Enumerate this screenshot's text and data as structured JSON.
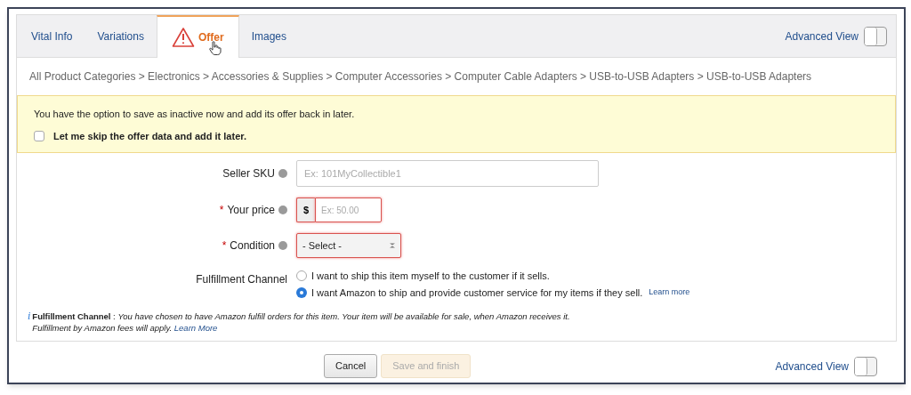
{
  "tabs": [
    {
      "label": "Vital Info",
      "selected": false,
      "warning": false
    },
    {
      "label": "Variations",
      "selected": false,
      "warning": false
    },
    {
      "label": "Offer",
      "selected": true,
      "warning": true
    },
    {
      "label": "Images",
      "selected": false,
      "warning": false
    }
  ],
  "advanced_view_top": {
    "label": "Advanced View",
    "on": false
  },
  "breadcrumb": "All Product Categories > Electronics > Accessories & Supplies > Computer Accessories > Computer Cable Adapters > USB-to-USB Adapters > USB-to-USB Adapters",
  "notice": {
    "text": "You have the option to save as inactive now and add its offer back in later.",
    "checkbox": {
      "label": "Let me skip the offer data and add it later.",
      "checked": false
    }
  },
  "fields": [
    {
      "kind": "text",
      "label": "Seller SKU",
      "error": false,
      "placeholder": "Ex: 101MyCollectible1"
    },
    {
      "kind": "price",
      "label": "Your price",
      "required_mark": "*",
      "error": true,
      "prefix": "$",
      "placeholder": "Ex: 50.00"
    },
    {
      "kind": "select",
      "label": "Condition",
      "required_mark": "*",
      "error": true,
      "value": "- Select -"
    }
  ],
  "fulfillment": {
    "label": "Fulfillment Channel",
    "options": [
      {
        "label": "I want to ship this item myself to the customer if it sells.",
        "selected": false
      },
      {
        "label": "I want Amazon to ship and provide customer service for my items if they sell.",
        "selected": true,
        "link": "Learn more"
      }
    ]
  },
  "note": {
    "icon": "i",
    "lines": [
      "**Fulfillment Channel** : *You have chosen to have Amazon fulfill orders for this item. Your item will be available for sale, when Amazon receives it.*",
      "*Fulfillment by Amazon fees will apply.*"
    ],
    "link": "Learn More"
  },
  "buttons": [
    {
      "label": "Cancel",
      "disabled": false
    },
    {
      "label": "Save and finish",
      "disabled": true
    }
  ],
  "advanced_view_bottom": {
    "label": "Advanced View",
    "on": false
  }
}
